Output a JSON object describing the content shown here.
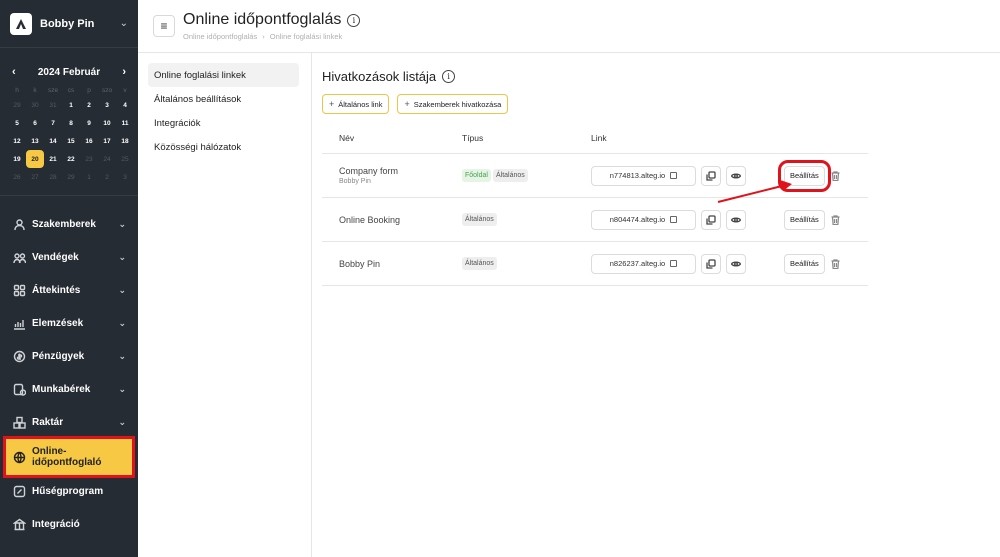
{
  "app": {
    "user_name": "Bobby Pin"
  },
  "calendar": {
    "month_label": "2024 Február",
    "weekdays": [
      "h",
      "k",
      "sze",
      "cs",
      "p",
      "szo",
      "v"
    ],
    "weeks": [
      [
        {
          "d": "29",
          "m": true
        },
        {
          "d": "30",
          "m": true
        },
        {
          "d": "31",
          "m": true
        },
        {
          "d": "1"
        },
        {
          "d": "2"
        },
        {
          "d": "3"
        },
        {
          "d": "4"
        }
      ],
      [
        {
          "d": "5"
        },
        {
          "d": "6"
        },
        {
          "d": "7"
        },
        {
          "d": "8"
        },
        {
          "d": "9"
        },
        {
          "d": "10"
        },
        {
          "d": "11"
        }
      ],
      [
        {
          "d": "12"
        },
        {
          "d": "13"
        },
        {
          "d": "14"
        },
        {
          "d": "15"
        },
        {
          "d": "16"
        },
        {
          "d": "17"
        },
        {
          "d": "18"
        }
      ],
      [
        {
          "d": "19"
        },
        {
          "d": "20",
          "today": true
        },
        {
          "d": "21"
        },
        {
          "d": "22"
        },
        {
          "d": "23",
          "m": true
        },
        {
          "d": "24",
          "m": true
        },
        {
          "d": "25",
          "m": true
        }
      ],
      [
        {
          "d": "26",
          "m": true
        },
        {
          "d": "27",
          "m": true
        },
        {
          "d": "28",
          "m": true
        },
        {
          "d": "29",
          "m": true
        },
        {
          "d": "1",
          "m": true
        },
        {
          "d": "2",
          "m": true
        },
        {
          "d": "3",
          "m": true
        }
      ]
    ]
  },
  "sidebar": {
    "items": [
      {
        "label": "Szakemberek",
        "icon": "person-icon",
        "chevron": true
      },
      {
        "label": "Vendégek",
        "icon": "people-icon",
        "chevron": true
      },
      {
        "label": "Áttekintés",
        "icon": "grid-icon",
        "chevron": true
      },
      {
        "label": "Elemzések",
        "icon": "chart-icon",
        "chevron": true
      },
      {
        "label": "Pénzügyek",
        "icon": "money-icon",
        "chevron": true
      },
      {
        "label": "Munkabérek",
        "icon": "payroll-icon",
        "chevron": true
      },
      {
        "label": "Raktár",
        "icon": "boxes-icon",
        "chevron": true
      },
      {
        "label": "Online-időpontfoglaló",
        "icon": "globe-icon",
        "chevron": false,
        "active": true
      },
      {
        "label": "Hűségprogram",
        "icon": "loyalty-icon",
        "chevron": false
      },
      {
        "label": "Integráció",
        "icon": "integration-icon",
        "chevron": false
      }
    ]
  },
  "header": {
    "title": "Online időpontfoglalás",
    "breadcrumb": [
      "Online időpontfoglalás",
      "Online foglalási linkek"
    ]
  },
  "subnav": {
    "items": [
      "Online foglalási linkek",
      "Általános beállítások",
      "Integrációk",
      "Közösségi hálózatok"
    ]
  },
  "main": {
    "section_title": "Hivatkozások listája",
    "buttons": [
      "Általános link",
      "Szakemberek hivatkozása"
    ],
    "columns": [
      "Név",
      "Típus",
      "Link"
    ],
    "rows": [
      {
        "name": "Company form",
        "sub": "Bobby Pin",
        "tags": [
          {
            "t": "Főoldal",
            "green": true
          },
          {
            "t": "Általános"
          }
        ],
        "link": "n774813.alteg.io",
        "settings": "Beállítás",
        "highlight": true
      },
      {
        "name": "Online Booking",
        "sub": "",
        "tags": [
          {
            "t": "Általános"
          }
        ],
        "link": "n804474.alteg.io",
        "settings": "Beállítás"
      },
      {
        "name": "Bobby Pin",
        "sub": "",
        "tags": [
          {
            "t": "Általános"
          }
        ],
        "link": "n826237.alteg.io",
        "settings": "Beállítás"
      }
    ]
  },
  "colors": {
    "sidebar_bg": "#262c33",
    "accent": "#f6c844",
    "highlight_red": "#e0121b"
  }
}
